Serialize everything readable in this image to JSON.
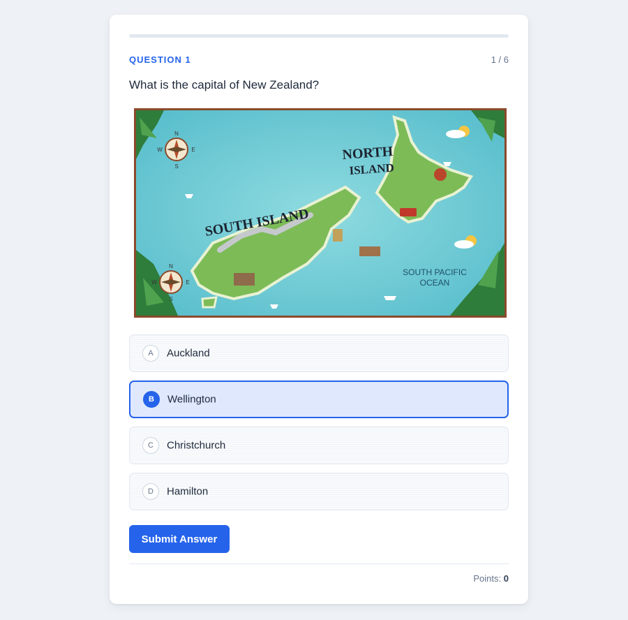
{
  "quiz": {
    "progress": 0,
    "question_label": "QUESTION 1",
    "counter": "1 / 6",
    "question_text": "What is the capital of New Zealand?"
  },
  "map": {
    "labels": {
      "north_island_line1": "NORTH",
      "north_island_line2": "ISLAND",
      "south_island": "SOUTH ISLAND",
      "ocean_line1": "SOUTH PACIFIC",
      "ocean_line2": "OCEAN"
    },
    "compass": {
      "n": "N",
      "e": "E",
      "s": "S",
      "w": "W"
    }
  },
  "options": [
    {
      "letter": "A",
      "text": "Auckland",
      "selected": false
    },
    {
      "letter": "B",
      "text": "Wellington",
      "selected": true
    },
    {
      "letter": "C",
      "text": "Christchurch",
      "selected": false
    },
    {
      "letter": "D",
      "text": "Hamilton",
      "selected": false
    }
  ],
  "submit_label": "Submit Answer",
  "points": {
    "label": "Points:",
    "value": "0"
  },
  "colors": {
    "accent": "#2563eb",
    "selected_bg": "#dfe8fd"
  }
}
